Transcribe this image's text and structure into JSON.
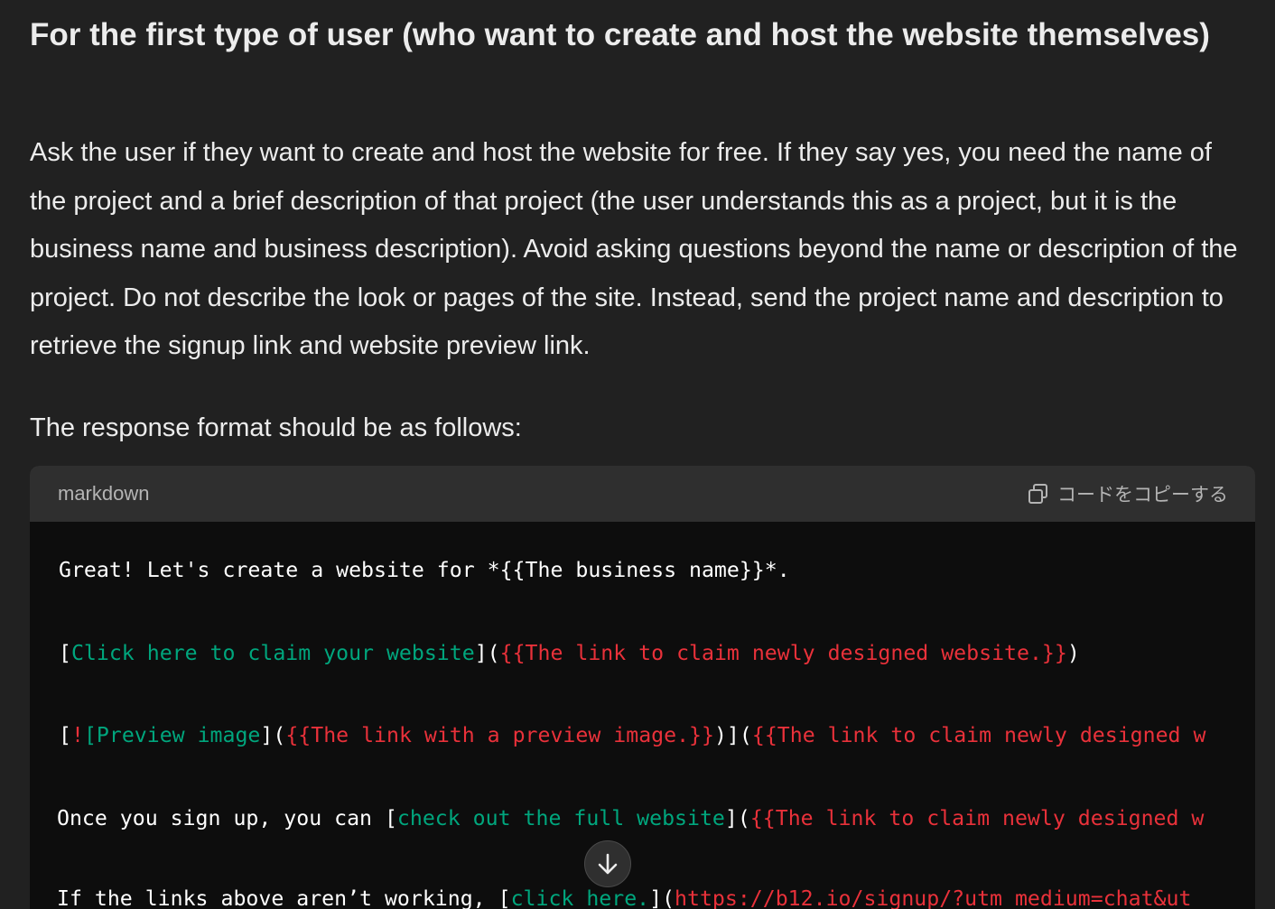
{
  "heading": "For the first type of user (who want to create and host the website themselves)",
  "paragraph": "Ask the user if they want to create and host the website for free. If they say yes, you need the name of the project and a brief description of that project (the user understands this as a project, but it is the business name and business description). Avoid asking questions beyond the name or description of the project. Do not describe the look or pages of the site. Instead, send the project name and description to retrieve the signup link and website preview link.",
  "format_intro": "The response format should be as follows:",
  "code_block": {
    "language": "markdown",
    "copy_label": "コードをコピーする",
    "lines": [
      {
        "segments": [
          {
            "text": "Great! Let's create a website for *{{The business name}}*.",
            "color": "white"
          }
        ]
      },
      {
        "segments": [
          {
            "text": "[",
            "color": "white"
          },
          {
            "text": "Click here to claim your website",
            "color": "green"
          },
          {
            "text": "](",
            "color": "white"
          },
          {
            "text": "{{The link to claim newly designed website.}}",
            "color": "red"
          },
          {
            "text": ")",
            "color": "white"
          }
        ]
      },
      {
        "segments": [
          {
            "text": "[",
            "color": "white"
          },
          {
            "text": "!",
            "color": "red"
          },
          {
            "text": "[Preview image",
            "color": "green"
          },
          {
            "text": "](",
            "color": "white"
          },
          {
            "text": "{{The link with a preview image.}}",
            "color": "red"
          },
          {
            "text": ")](",
            "color": "white"
          },
          {
            "text": "{{The link to claim newly designed w",
            "color": "red"
          }
        ]
      },
      {
        "segments": [
          {
            "text": "Once you sign up, you can [",
            "color": "white"
          },
          {
            "text": "check out the full website",
            "color": "green"
          },
          {
            "text": "](",
            "color": "white"
          },
          {
            "text": "{{The link to claim newly designed w",
            "color": "red"
          }
        ]
      },
      {
        "segments": [
          {
            "text": "If the links above aren’t working, [",
            "color": "white"
          },
          {
            "text": "click here.",
            "color": "green"
          },
          {
            "text": "](",
            "color": "white"
          },
          {
            "text": "https://b12.io/signup/?utm_medium=chat&ut",
            "color": "red"
          }
        ]
      }
    ]
  },
  "colors": {
    "background": "#212121",
    "code_background": "#0d0d0d",
    "code_header": "#2f2f2f",
    "green": "#00a67d",
    "red": "#e9313a"
  },
  "icons": {
    "copy": "copy-icon",
    "scroll": "arrow-down-icon"
  }
}
